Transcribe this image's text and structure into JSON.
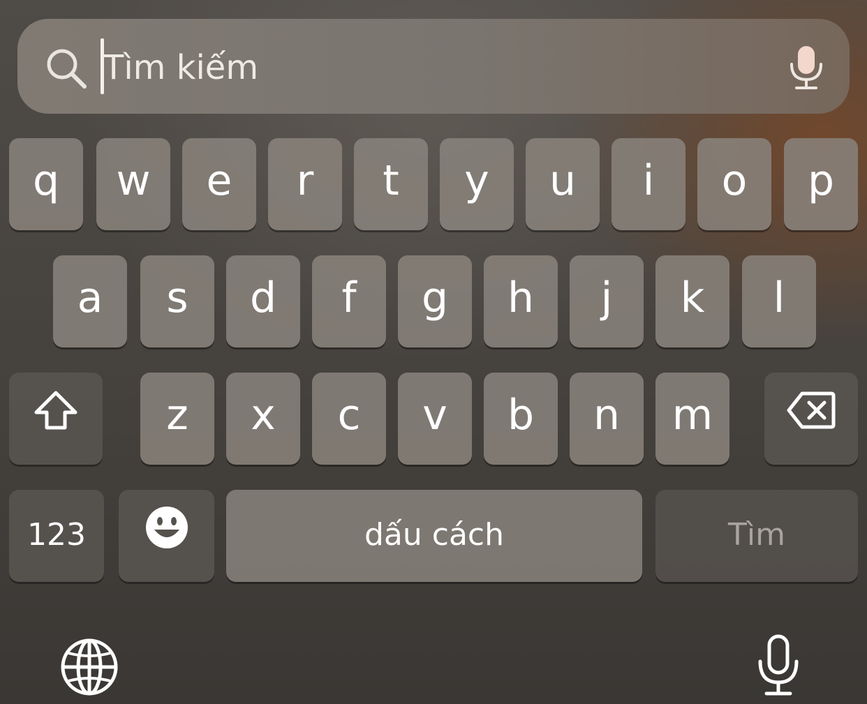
{
  "search": {
    "placeholder": "Tìm kiếm",
    "search_icon": "magnifier-icon",
    "mic_icon": "dictation-mic-icon"
  },
  "keyboard": {
    "row1": [
      "q",
      "w",
      "e",
      "r",
      "t",
      "y",
      "u",
      "i",
      "o",
      "p"
    ],
    "row2": [
      "a",
      "s",
      "d",
      "f",
      "g",
      "h",
      "j",
      "k",
      "l"
    ],
    "row3": [
      "z",
      "x",
      "c",
      "v",
      "b",
      "n",
      "m"
    ],
    "shift_icon": "shift-arrow-icon",
    "delete_icon": "backspace-icon",
    "numbers_label": "123",
    "emoji_icon": "smiley-emoji-icon",
    "space_label": "dấu cách",
    "return_label": "Tìm",
    "globe_icon": "globe-icon",
    "dictation_icon": "microphone-icon"
  },
  "colors": {
    "key_fill": "#8a847d",
    "func_key_fill": "#58544f",
    "accent_brown": "#784828"
  }
}
